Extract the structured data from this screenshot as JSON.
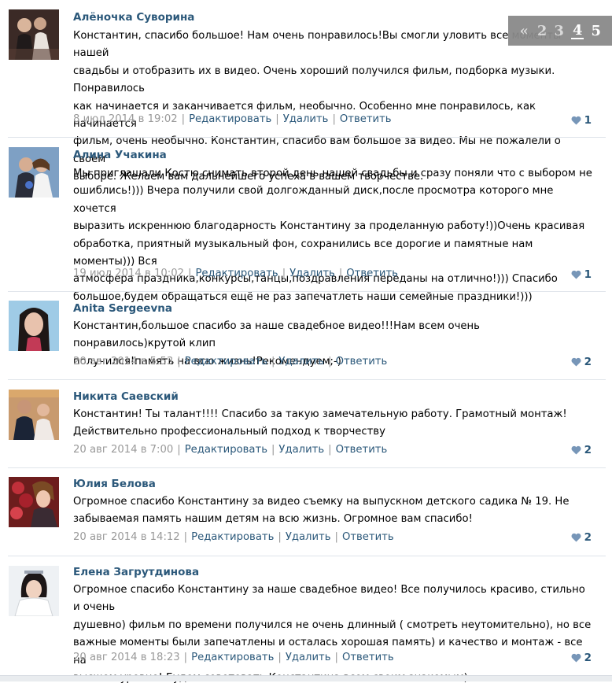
{
  "pagination": {
    "prev": "«",
    "pages": [
      "2",
      "3",
      "4",
      "5"
    ],
    "current": "4"
  },
  "actions": {
    "edit": "Редактировать",
    "delete": "Удалить",
    "reply": "Ответить"
  },
  "comments": [
    {
      "author": "Алёночка Суворина",
      "text": "Константин, спасибо большое! Нам очень понравилось!Вы смогли уловить все моменты нашей\nсвадьбы и отобразить их в видео. Очень хороший получился фильм, подборка музыки. Понравилось\nкак начинается и заканчивается фильм, необычно. Особенно мне понравилось, как начинается\nфильм, очень необычно. Константин, спасибо вам большое за видео. Мы не пожалели о своем\nвыборе. Желаем вам дальнейшего успеха в вашем творчестве.",
      "date": "8 июл 2014 в 19:02",
      "likes": "1"
    },
    {
      "author": "Алина Учакина",
      "text": "Мы приглашали Костю снимать второй день нашей свадьбы и сразу поняли что с выбором не\nошиблись!))) Вчера получили свой долгожданный диск,после просмотра которого мне хочется\nвыразить искреннюю благодарность Константину за проделанную работу!))Очень красивая\nобработка, приятный музыкальный фон, сохранились все дорогие и памятные нам моменты))) Вся\nатмосфера праздника,конкурсы,танцы,поздравления переданы на отлично!))) Спасибо\nбольшое,будем обращаться ещё не раз запечатлеть наши семейные праздники!)))",
      "date": "19 июл 2014 в 10:02",
      "likes": "1"
    },
    {
      "author": "Anita Sergeevna",
      "text": "Константин,большое спасибо за наше свадебное видео!!!Нам всем очень понравилось)крутой клип\nполучился!память на всю жизнь!Рекомендуем;-)",
      "date": "20 авг 2014 в 5:53",
      "likes": "2"
    },
    {
      "author": "Никита Саевский",
      "text": "Константин! Ты талант!!!! Спасибо за такую замечательную работу. Грамотный монтаж!\nДействительно профессиональный подход к творчеству",
      "date": "20 авг 2014 в 7:00",
      "likes": "2"
    },
    {
      "author": "Юлия Белова",
      "text": "Огромное спасибо Константину за видео съемку на выпускном детского садика № 19. Не\nзабываемая память нашим детям на всю жизнь. Огромное вам спасибо!",
      "date": "20 авг 2014 в 14:12",
      "likes": "2"
    },
    {
      "author": "Елена Загрутдинова",
      "text": "Огромное спасибо Константину за наше свадебное видео! Все получилось красиво, стильно и очень\nдушевно) фильм по времени получился не очень длинный ( смотреть неутомительно), но все\nважные моменты были запечатлены и осталась хорошая память) и качество и монтаж - все на\nвысшем уровне! Будем советовать Константина всем своим знакомым)",
      "date": "20 авг 2014 в 18:23",
      "likes": "2"
    }
  ]
}
